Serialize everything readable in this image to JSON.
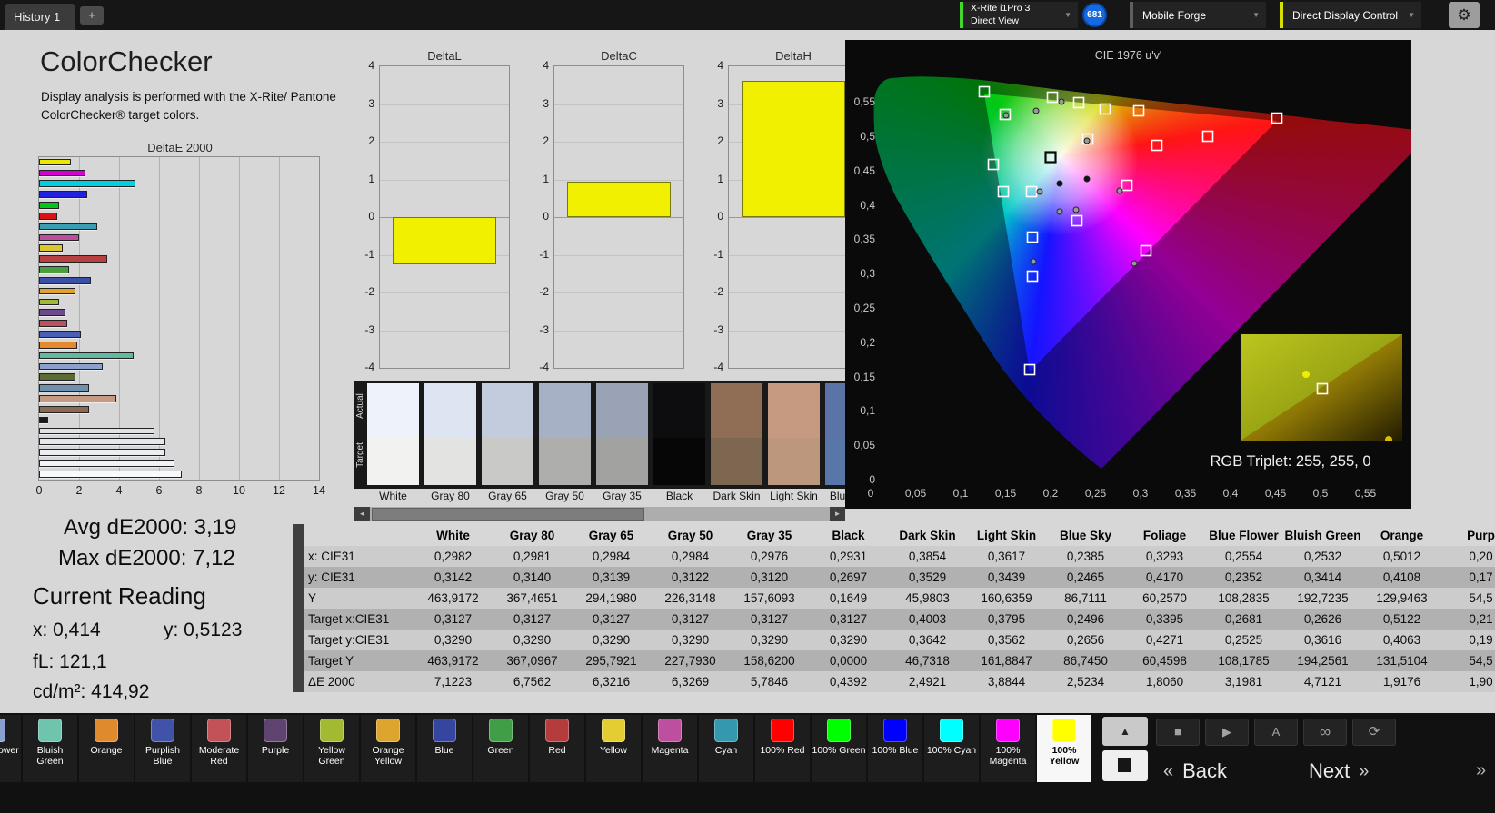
{
  "topbar": {
    "history_tab": "History 1",
    "meter_line1": "X-Rite i1Pro 3",
    "meter_line2": "Direct View",
    "meter_accent": "#44d62c",
    "badge": "681",
    "source_label": "Mobile Forge",
    "source_accent": "#5f5f5f",
    "workflow_label": "Direct Display Control",
    "workflow_accent": "#d6e000"
  },
  "icons": {
    "plus": "+",
    "gear": "⚙",
    "caret": "▼",
    "up": "▲",
    "stop": "■",
    "play": "▶",
    "a": "A",
    "infinity": "∞",
    "refresh": "⟳",
    "left": "◄",
    "right": "►",
    "chevron_left": "«",
    "chevron_right": "»"
  },
  "colorchecker": {
    "title": "ColorChecker",
    "description": "Display analysis is performed with the X-Rite/ Pantone ColorChecker® target colors."
  },
  "stats": {
    "avg": "Avg dE2000: 3,19",
    "max": "Max dE2000: 7,12",
    "current_reading": "Current Reading",
    "x": "x: 0,414",
    "y": "y: 0,5123",
    "fl": "fL: 121,1",
    "cdm2": "cd/m²: 414,92"
  },
  "deltae_chart": {
    "type": "bar",
    "title": "DeltaE 2000",
    "xlim": [
      0,
      14
    ],
    "xticks": [
      0,
      2,
      4,
      6,
      8,
      10,
      12,
      14
    ],
    "bars": [
      {
        "name": "100% Yellow",
        "value": 1.6,
        "color": "#e8e800"
      },
      {
        "name": "100% Magenta",
        "value": 2.3,
        "color": "#d400d4"
      },
      {
        "name": "100% Cyan",
        "value": 4.8,
        "color": "#00d0e0"
      },
      {
        "name": "100% Blue",
        "value": 2.4,
        "color": "#2222dd"
      },
      {
        "name": "100% Green",
        "value": 1.0,
        "color": "#00c818"
      },
      {
        "name": "100% Red",
        "value": 0.9,
        "color": "#dd1111"
      },
      {
        "name": "Cyan",
        "value": 2.9,
        "color": "#3a9db0"
      },
      {
        "name": "Magenta",
        "value": 2.0,
        "color": "#bb4f9b"
      },
      {
        "name": "Yellow",
        "value": 1.2,
        "color": "#ddc72e"
      },
      {
        "name": "Red",
        "value": 3.4,
        "color": "#b94040"
      },
      {
        "name": "Green",
        "value": 1.5,
        "color": "#4a9e3f"
      },
      {
        "name": "Blue",
        "value": 2.6,
        "color": "#3b4fa5"
      },
      {
        "name": "Orange Yellow",
        "value": 1.8,
        "color": "#dda32e"
      },
      {
        "name": "Yellow Green",
        "value": 1.0,
        "color": "#9fba3a"
      },
      {
        "name": "Purple",
        "value": 1.3,
        "color": "#6b4b8a"
      },
      {
        "name": "Moderate Red",
        "value": 1.4,
        "color": "#c05060"
      },
      {
        "name": "Purplish Blue",
        "value": 2.1,
        "color": "#4a5fb4"
      },
      {
        "name": "Orange",
        "value": 1.92,
        "color": "#e8882e"
      },
      {
        "name": "Bluish Green",
        "value": 4.71,
        "color": "#63b8a0"
      },
      {
        "name": "Blue Flower",
        "value": 3.2,
        "color": "#8ba0cc"
      },
      {
        "name": "Foliage",
        "value": 1.81,
        "color": "#5a6b35"
      },
      {
        "name": "Blue Sky",
        "value": 2.52,
        "color": "#7090b0"
      },
      {
        "name": "Light Skin",
        "value": 3.88,
        "color": "#c49a82"
      },
      {
        "name": "Dark Skin",
        "value": 2.49,
        "color": "#8a6a52"
      },
      {
        "name": "Black",
        "value": 0.44,
        "color": "#1a1a1a"
      },
      {
        "name": "Gray 35",
        "value": 5.78,
        "color": "#dfe3e8"
      },
      {
        "name": "Gray 50",
        "value": 6.33,
        "color": "#e4e8ec"
      },
      {
        "name": "Gray 65",
        "value": 6.32,
        "color": "#eaedf1"
      },
      {
        "name": "Gray 80",
        "value": 6.76,
        "color": "#f0f3f7"
      },
      {
        "name": "White",
        "value": 7.12,
        "color": "#f7fafc"
      }
    ]
  },
  "delta_axis": {
    "yticks": [
      "4",
      "3",
      "2",
      "1",
      "0",
      "-1",
      "-2",
      "-3",
      "-4"
    ],
    "ylim": [
      -4,
      4
    ]
  },
  "delta_charts": [
    {
      "type": "bar",
      "title": "DeltaL",
      "value": -1.25,
      "color": "#f0f000"
    },
    {
      "type": "bar",
      "title": "DeltaC",
      "value": 0.94,
      "color": "#f0f000"
    },
    {
      "type": "bar",
      "title": "DeltaH",
      "value": 3.62,
      "color": "#f0f000"
    }
  ],
  "patch_strip": {
    "row_labels": [
      "Actual",
      "Target"
    ],
    "patches": [
      {
        "name": "White",
        "actual": "#edf2fb",
        "target": "#f2f2f0"
      },
      {
        "name": "Gray 80",
        "actual": "#dde5f2",
        "target": "#e3e3e1"
      },
      {
        "name": "Gray 65",
        "actual": "#c3ccdd",
        "target": "#c9c9c7"
      },
      {
        "name": "Gray 50",
        "actual": "#a7b1c5",
        "target": "#aeaeac"
      },
      {
        "name": "Gray 35",
        "actual": "#9aa3b5",
        "target": "#a2a2a0"
      },
      {
        "name": "Black",
        "actual": "#0d0d0f",
        "target": "#060606"
      },
      {
        "name": "Dark Skin",
        "actual": "#8f6e55",
        "target": "#7e6750"
      },
      {
        "name": "Light Skin",
        "actual": "#c59a81",
        "target": "#bd967e"
      },
      {
        "name": "Blue Sky",
        "actual": "#5a74a8",
        "target": "#5876a8"
      }
    ]
  },
  "cie": {
    "title": "CIE 1976 u'v'",
    "rgb_triplet": "RGB Triplet: 255, 255, 0",
    "yticks": [
      [
        0.55,
        "0,55"
      ],
      [
        0.5,
        "0,5"
      ],
      [
        0.45,
        "0,45"
      ],
      [
        0.4,
        "0,4"
      ],
      [
        0.35,
        "0,35"
      ],
      [
        0.3,
        "0,3"
      ],
      [
        0.25,
        "0,25"
      ],
      [
        0.2,
        "0,2"
      ],
      [
        0.15,
        "0,15"
      ],
      [
        0.1,
        "0,1"
      ],
      [
        0.05,
        "0,05"
      ],
      [
        0,
        "0"
      ]
    ],
    "xticks": [
      [
        0,
        "0"
      ],
      [
        0.05,
        "0,05"
      ],
      [
        0.1,
        "0,1"
      ],
      [
        0.15,
        "0,15"
      ],
      [
        0.2,
        "0,2"
      ],
      [
        0.25,
        "0,25"
      ],
      [
        0.3,
        "0,3"
      ],
      [
        0.35,
        "0,35"
      ],
      [
        0.4,
        "0,4"
      ],
      [
        0.45,
        "0,45"
      ],
      [
        0.5,
        "0,5"
      ],
      [
        0.55,
        "0,55"
      ]
    ],
    "target_squares": [
      [
        153,
        57
      ],
      [
        176,
        82
      ],
      [
        228,
        63
      ],
      [
        257,
        69
      ],
      [
        286,
        76
      ],
      [
        323,
        78
      ],
      [
        475,
        86
      ],
      [
        399,
        106
      ],
      [
        343,
        116
      ],
      [
        267,
        109
      ],
      [
        310,
        160
      ],
      [
        163,
        137
      ],
      [
        174,
        167
      ],
      [
        205,
        167
      ],
      [
        255,
        199
      ],
      [
        206,
        217
      ],
      [
        331,
        232
      ],
      [
        206,
        260
      ],
      [
        203,
        363
      ]
    ],
    "whitepoint_square": [
      226,
      129
    ],
    "measured_dots": [
      [
        210,
        78
      ],
      [
        238,
        68
      ],
      [
        266,
        111
      ],
      [
        302,
        166
      ],
      [
        254,
        187
      ],
      [
        318,
        246
      ],
      [
        207,
        244
      ],
      [
        177,
        83
      ],
      [
        214,
        167
      ],
      [
        236,
        189
      ]
    ],
    "dark_dots": [
      [
        236,
        158
      ],
      [
        266,
        153
      ]
    ],
    "inset_markers": {
      "dot1": [
        72,
        44
      ],
      "square": [
        90,
        60
      ],
      "dot2": [
        163,
        116
      ]
    }
  },
  "table": {
    "columns": [
      "",
      "White",
      "Gray 80",
      "Gray 65",
      "Gray 50",
      "Gray 35",
      "Black",
      "Dark Skin",
      "Light Skin",
      "Blue Sky",
      "Foliage",
      "Blue Flower",
      "Bluish Green",
      "Orange",
      "Purp"
    ],
    "rows": [
      {
        "label": "x: CIE31",
        "values": [
          "0,2982",
          "0,2981",
          "0,2984",
          "0,2984",
          "0,2976",
          "0,2931",
          "0,3854",
          "0,3617",
          "0,2385",
          "0,3293",
          "0,2554",
          "0,2532",
          "0,5012",
          "0,20"
        ]
      },
      {
        "label": "y: CIE31",
        "values": [
          "0,3142",
          "0,3140",
          "0,3139",
          "0,3122",
          "0,3120",
          "0,2697",
          "0,3529",
          "0,3439",
          "0,2465",
          "0,4170",
          "0,2352",
          "0,3414",
          "0,4108",
          "0,17"
        ]
      },
      {
        "label": "Y",
        "values": [
          "463,9172",
          "367,4651",
          "294,1980",
          "226,3148",
          "157,6093",
          "0,1649",
          "45,9803",
          "160,6359",
          "86,7111",
          "60,2570",
          "108,2835",
          "192,7235",
          "129,9463",
          "54,5"
        ]
      },
      {
        "label": "Target x:CIE31",
        "values": [
          "0,3127",
          "0,3127",
          "0,3127",
          "0,3127",
          "0,3127",
          "0,3127",
          "0,4003",
          "0,3795",
          "0,2496",
          "0,3395",
          "0,2681",
          "0,2626",
          "0,5122",
          "0,21"
        ]
      },
      {
        "label": "Target y:CIE31",
        "values": [
          "0,3290",
          "0,3290",
          "0,3290",
          "0,3290",
          "0,3290",
          "0,3290",
          "0,3642",
          "0,3562",
          "0,2656",
          "0,4271",
          "0,2525",
          "0,3616",
          "0,4063",
          "0,19"
        ]
      },
      {
        "label": "Target Y",
        "values": [
          "463,9172",
          "367,0967",
          "295,7921",
          "227,7930",
          "158,6200",
          "0,0000",
          "46,7318",
          "161,8847",
          "86,7450",
          "60,4598",
          "108,1785",
          "194,2561",
          "131,5104",
          "54,5"
        ]
      },
      {
        "label": "ΔE 2000",
        "values": [
          "7,1223",
          "6,7562",
          "6,3216",
          "6,3269",
          "5,7846",
          "0,4392",
          "2,4921",
          "3,8844",
          "2,5234",
          "1,8060",
          "3,1981",
          "4,7121",
          "1,9176",
          "1,90"
        ]
      }
    ]
  },
  "bottom": {
    "back": "Back",
    "next": "Next",
    "tiles": [
      {
        "label": "Blue Flower",
        "color": "#8ba0cc",
        "partial": true
      },
      {
        "label": "Bluish Green",
        "color": "#6fc4ad"
      },
      {
        "label": "Orange",
        "color": "#e08a2e"
      },
      {
        "label": "Purplish Blue",
        "color": "#4053a8"
      },
      {
        "label": "Moderate Red",
        "color": "#c25158"
      },
      {
        "label": "Purple",
        "color": "#5f4470"
      },
      {
        "label": "Yellow Green",
        "color": "#a2ba32"
      },
      {
        "label": "Orange Yellow",
        "color": "#dda42e"
      },
      {
        "label": "Blue",
        "color": "#3646a0"
      },
      {
        "label": "Green",
        "color": "#3f9e46"
      },
      {
        "label": "Red",
        "color": "#b43c3c"
      },
      {
        "label": "Yellow",
        "color": "#e3cd32"
      },
      {
        "label": "Magenta",
        "color": "#bc4f9e"
      },
      {
        "label": "Cyan",
        "color": "#3498ae"
      },
      {
        "label": "100% Red",
        "color": "#ff0000"
      },
      {
        "label": "100% Green",
        "color": "#00ff00"
      },
      {
        "label": "100% Blue",
        "color": "#0000ff"
      },
      {
        "label": "100% Cyan",
        "color": "#00ffff"
      },
      {
        "label": "100% Magenta",
        "color": "#ff00ff"
      },
      {
        "label": "100% Yellow",
        "color": "#ffff00",
        "selected": true
      }
    ]
  }
}
